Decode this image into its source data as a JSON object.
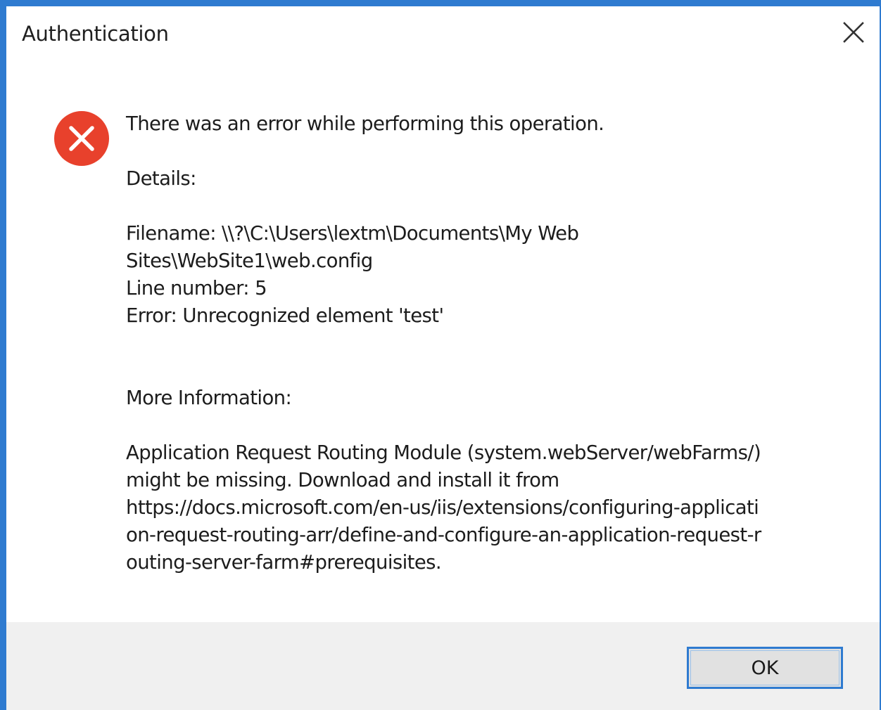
{
  "window": {
    "title": "Authentication",
    "close_icon": "close-icon"
  },
  "colors": {
    "accent_border": "#2f7bd0",
    "error_icon": "#e8412c",
    "footer_background": "#f0f0f0"
  },
  "message": {
    "icon": "error-icon",
    "headline": "There was an error while performing this operation.",
    "details_label": "Details:",
    "filename_line1": "Filename: \\\\?\\C:\\Users\\lextm\\Documents\\My Web",
    "filename_line2": "Sites\\WebSite1\\web.config",
    "line_number": "Line number: 5",
    "error": "Error: Unrecognized element 'test'",
    "more_info_label": "More Information:",
    "more_info_line1": "Application Request Routing Module (system.webServer/webFarms/)",
    "more_info_line2": "might be missing. Download and install it from",
    "more_info_line3": "https://docs.microsoft.com/en-us/iis/extensions/configuring-applicati",
    "more_info_line4": "on-request-routing-arr/define-and-configure-an-application-request-r",
    "more_info_line5": "outing-server-farm#prerequisites."
  },
  "footer": {
    "ok_label": "OK"
  }
}
